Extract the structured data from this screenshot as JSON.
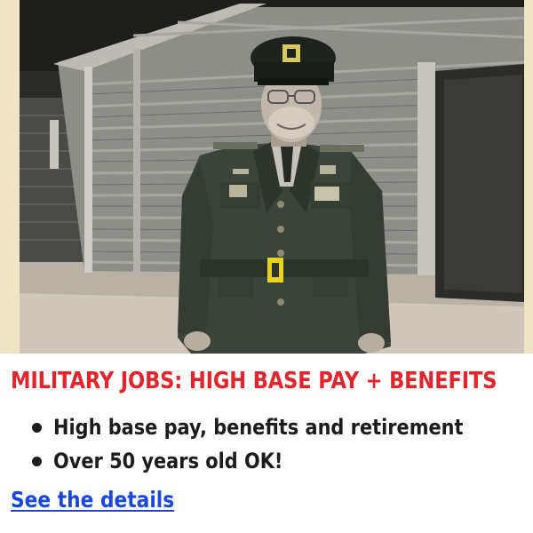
{
  "ad": {
    "headline": "MILITARY JOBS: HIGH BASE PAY + BENEFITS",
    "bullets": [
      "High base pay, benefits and retirement",
      "Over 50 years old OK!"
    ],
    "cta_label": "See the details"
  },
  "colors": {
    "headline": "#e0262c",
    "bullet_text": "#1c1c1c",
    "link": "#1a47e0",
    "photo_border": "#efe4c4"
  }
}
